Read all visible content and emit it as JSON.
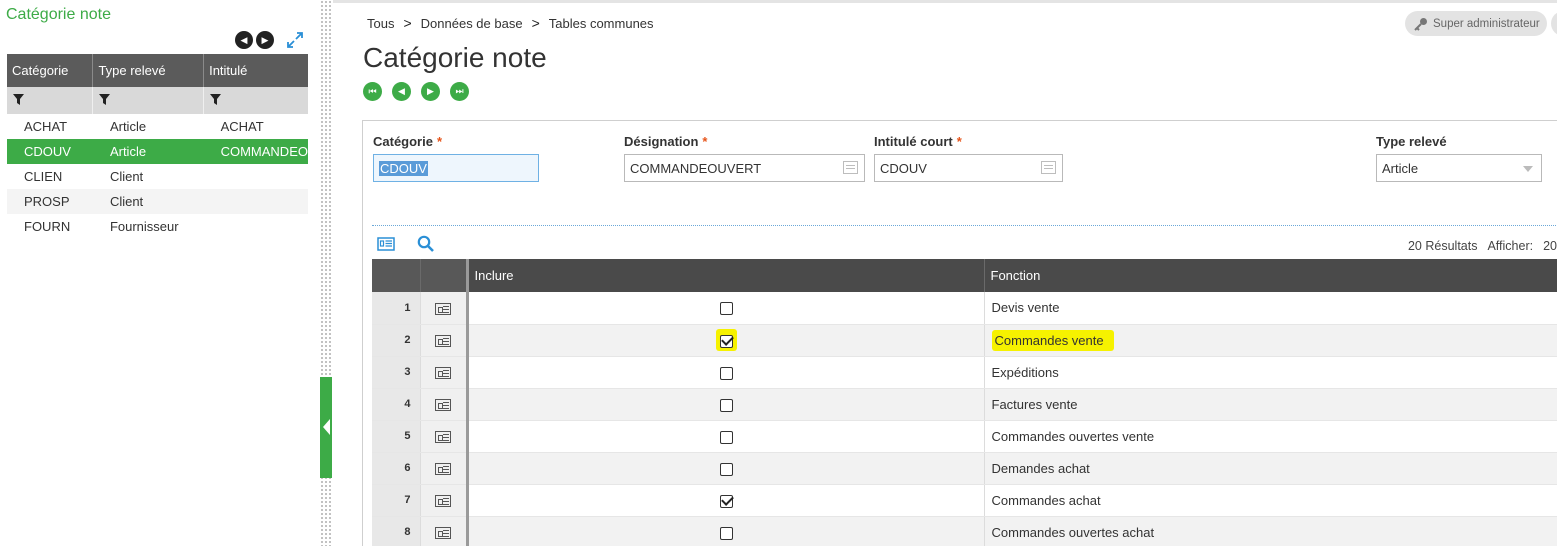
{
  "left_panel": {
    "title": "Catégorie note",
    "columns": [
      "Catégorie",
      "Type relevé",
      "Intitulé"
    ],
    "rows": [
      {
        "categorie": "ACHAT",
        "type": "Article",
        "intitule": "ACHAT"
      },
      {
        "categorie": "CDOUV",
        "type": "Article",
        "intitule": "COMMANDEO"
      },
      {
        "categorie": "CLIEN",
        "type": "Client",
        "intitule": ""
      },
      {
        "categorie": "PROSP",
        "type": "Client",
        "intitule": ""
      },
      {
        "categorie": "FOURN",
        "type": "Fournisseur",
        "intitule": ""
      }
    ],
    "selected_index": 1
  },
  "breadcrumb": [
    "Tous",
    "Données de base",
    "Tables communes"
  ],
  "breadcrumb_sep": ">",
  "user": {
    "label": "Super administrateur"
  },
  "page_title": "Catégorie note",
  "form": {
    "categorie": {
      "label": "Catégorie",
      "value": "CDOUV"
    },
    "designation": {
      "label": "Désignation",
      "value": "COMMANDEOUVERT"
    },
    "intitule_court": {
      "label": "Intitulé court",
      "value": "CDOUV"
    },
    "type_releve": {
      "label": "Type relevé",
      "value": "Article"
    },
    "required_mark": "*"
  },
  "grid": {
    "results_text": "20 Résultats",
    "show_text": "Afficher:",
    "show_value": "20",
    "columns": {
      "include": "Inclure",
      "function": "Fonction"
    },
    "rows": [
      {
        "n": "1",
        "checked": false,
        "fonction": "Devis vente",
        "highlight": false
      },
      {
        "n": "2",
        "checked": true,
        "fonction": "Commandes vente",
        "highlight": true
      },
      {
        "n": "3",
        "checked": false,
        "fonction": "Expéditions",
        "highlight": false
      },
      {
        "n": "4",
        "checked": false,
        "fonction": "Factures vente",
        "highlight": false
      },
      {
        "n": "5",
        "checked": false,
        "fonction": "Commandes ouvertes vente",
        "highlight": false
      },
      {
        "n": "6",
        "checked": false,
        "fonction": "Demandes achat",
        "highlight": false
      },
      {
        "n": "7",
        "checked": true,
        "fonction": "Commandes achat",
        "highlight": false
      },
      {
        "n": "8",
        "checked": false,
        "fonction": "Commandes ouvertes achat",
        "highlight": false
      }
    ]
  },
  "colors": {
    "accent_green": "#3dab47",
    "header_dark": "#4a4a4a",
    "highlight_yellow": "#f6f200"
  }
}
